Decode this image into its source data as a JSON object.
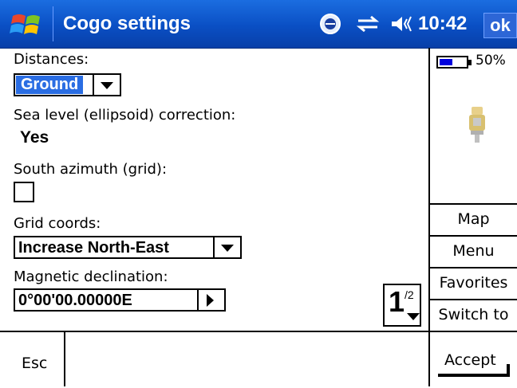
{
  "titlebar": {
    "title": "Cogo settings",
    "clock": "10:42",
    "ok_label": "ok",
    "icons": [
      "windows-logo-icon",
      "connectivity-icon",
      "sync-icon",
      "volume-icon"
    ]
  },
  "form": {
    "distances": {
      "label": "Distances:",
      "value": "Ground"
    },
    "sea_level": {
      "label": "Sea level (ellipsoid) correction:",
      "value": "Yes"
    },
    "south_azimuth": {
      "label": "South azimuth (grid):",
      "checked": false
    },
    "grid_coords": {
      "label": "Grid coords:",
      "value": "Increase North-East"
    },
    "magnetic": {
      "label": "Magnetic declination:",
      "value": "0°00'00.00000E"
    },
    "page": {
      "current": "1",
      "total": "/2"
    }
  },
  "side": {
    "battery_level": "50%",
    "battery_fraction": 0.5,
    "buttons": [
      "Map",
      "Menu",
      "Favorites",
      "Switch to"
    ]
  },
  "softkeys": {
    "left": "Esc",
    "right": "Accept"
  },
  "colors": {
    "titlebar": "#0a4fc4",
    "selection": "#2a6de3",
    "battery": "#0000dd"
  }
}
